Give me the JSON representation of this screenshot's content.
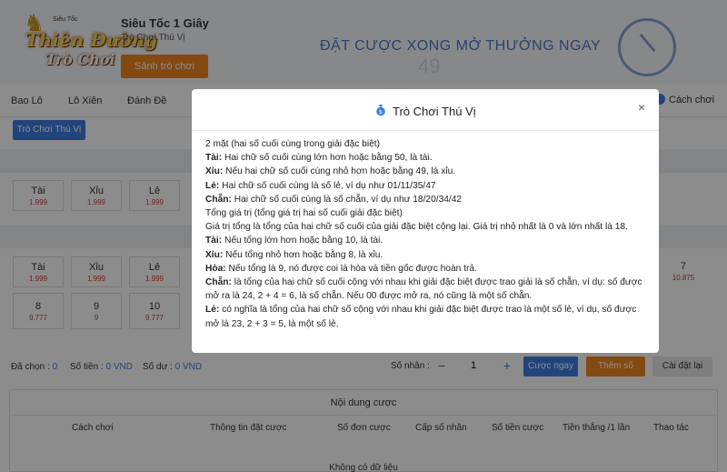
{
  "logo": {
    "line1": "Thiên Đường",
    "line2": "Trò Chơi",
    "top_text": "Siêu Tốc"
  },
  "header": {
    "game_title": "Siêu Tốc 1 Giây",
    "game_subtitle": "Trò Chơi Thú Vị",
    "lobby_button": "Sảnh trò chơi",
    "banner_text": "ĐẶT CƯỢC XONG MỞ THƯỞNG NGAY",
    "banner_num": "49"
  },
  "nav": {
    "items": [
      "Bao Lô",
      "Lô Xiên",
      "Đánh Đề"
    ],
    "toggle_label": "Cách chơi",
    "sub_tab": "Trò Chơi Thú Vị"
  },
  "odds_row1": [
    {
      "name": "Tài",
      "odd": "1.999"
    },
    {
      "name": "Xỉu",
      "odd": "1.999"
    },
    {
      "name": "Lẻ",
      "odd": "1.999"
    }
  ],
  "odds_row2": [
    {
      "name": "Tài",
      "odd": "1.999"
    },
    {
      "name": "Xỉu",
      "odd": "1.999"
    },
    {
      "name": "Lẻ",
      "odd": "1.999"
    }
  ],
  "odds_row3": [
    {
      "name": "8",
      "odd": "9.777"
    },
    {
      "name": "9",
      "odd": "9"
    },
    {
      "name": "10",
      "odd": "9.777"
    }
  ],
  "odds_right": {
    "name": "7",
    "odd": "10.875"
  },
  "summary": {
    "selected_label": "Đã chọn :",
    "selected_value": "0",
    "amount_label": "Số tiền :",
    "amount_value": "0 VND",
    "balance_label": "Số dư :",
    "balance_value": "0 VND",
    "multiplier_label": "Số nhân :",
    "multiplier_value": "1",
    "minus": "−",
    "plus": "+",
    "bet_now": "Cược ngay",
    "add_number": "Thêm số",
    "reset": "Cài đặt lại"
  },
  "content": {
    "title": "Nội dung cược",
    "columns": [
      "Cách chơi",
      "Thông tin đặt cược",
      "Số đơn cược",
      "Cấp số nhân",
      "Số tiền cược",
      "Tiền thắng /1 lần",
      "Thao tác"
    ],
    "empty": "Không có dữ liệu"
  },
  "modal": {
    "title": "Trò Chơi Thú Vị",
    "close": "×",
    "lines": [
      {
        "bold": "",
        "text": "2 mặt (hai số cuối cùng trong giải đặc biệt)"
      },
      {
        "bold": "Tài:",
        "text": " Hai chữ số cuối cùng lớn hơn hoặc bằng 50, là tài."
      },
      {
        "bold": "Xỉu:",
        "text": " Nếu hai chữ số cuối cùng nhỏ hơn hoặc bằng 49, là xỉu."
      },
      {
        "bold": "Lẻ:",
        "text": " Hai chữ số cuối cùng là số lẻ, ví dụ như 01/11/35/47"
      },
      {
        "bold": "Chẵn:",
        "text": " Hai chữ số cuối cùng là số chẵn, ví dụ như 18/20/34/42"
      },
      {
        "bold": "",
        "text": "Tổng giá trị (tổng giá trị hai số cuối giải đặc biệt)"
      },
      {
        "bold": "",
        "text": "Giá trị tổng là tổng của hai chữ số cuối của giải đặc biệt cộng lại. Giá trị nhỏ nhất là 0 và lớn nhất là 18."
      },
      {
        "bold": "Tài:",
        "text": " Nếu tổng lớn hơn hoặc bằng 10, là tài."
      },
      {
        "bold": "Xỉu:",
        "text": " Nếu tổng nhỏ hơn hoặc bằng 8, là xỉu."
      },
      {
        "bold": "Hòa:",
        "text": " Nếu tổng là 9, nó được coi là hòa và tiền gốc được hoàn trả."
      },
      {
        "bold": "Chẵn:",
        "text": " là tổng của hai chữ số cuối cộng với nhau khi giải đặc biệt được trao giải là số chẵn, ví dụ: số được mở ra là 24, 2 + 4 = 6, là số chẵn. Nếu 00 được mở ra, nó cũng là một số chẵn."
      },
      {
        "bold": "Lẻ:",
        "text": " có nghĩa là tổng của hai chữ số cộng với nhau khi giải đặc biệt được trao là một số lẻ, ví dụ, số được mở là 23, 2 + 3 = 5, là một số lẻ."
      }
    ]
  },
  "colors": {
    "accent_blue": "#3e7de3",
    "accent_orange": "#f0851f",
    "odds_red": "#d23b3b"
  }
}
